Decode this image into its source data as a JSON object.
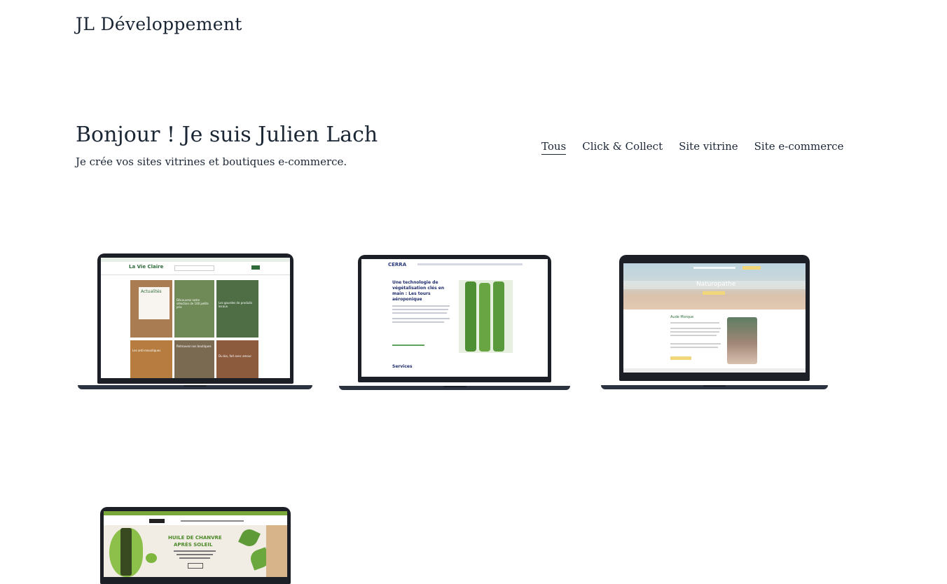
{
  "site": {
    "title": "JL Développement"
  },
  "hero": {
    "title": "Bonjour ! Je suis Julien Lach",
    "subtitle": "Je crée vos sites vitrines et boutiques e-commerce."
  },
  "filters": [
    {
      "label": "Tous",
      "active": true
    },
    {
      "label": "Click & Collect",
      "active": false
    },
    {
      "label": "Site vitrine",
      "active": false
    },
    {
      "label": "Site e-commerce",
      "active": false
    }
  ],
  "projects": [
    {
      "brand": "La Vie Claire",
      "screen_texts": [
        "Actualités",
        "Découvrez notre sélection de 100 petits prix",
        "Les gourdes de produits locaux",
        "Les anti-moustiques",
        "Retrouvez nos boutiques",
        "Du bio, fait avec amour"
      ]
    },
    {
      "brand": "CERRA",
      "screen_texts": [
        "Une technologie de végétalisation clés en main : Les tours aéroponique",
        "Services"
      ]
    },
    {
      "brand": "Naturopathe",
      "screen_texts": [
        "Naturopathe",
        "Aude Morque"
      ]
    },
    {
      "brand": "HUILE DE CHANVRE",
      "screen_texts": [
        "HUILE DE CHANVRE",
        "APRÈS SOLEIL"
      ]
    }
  ]
}
